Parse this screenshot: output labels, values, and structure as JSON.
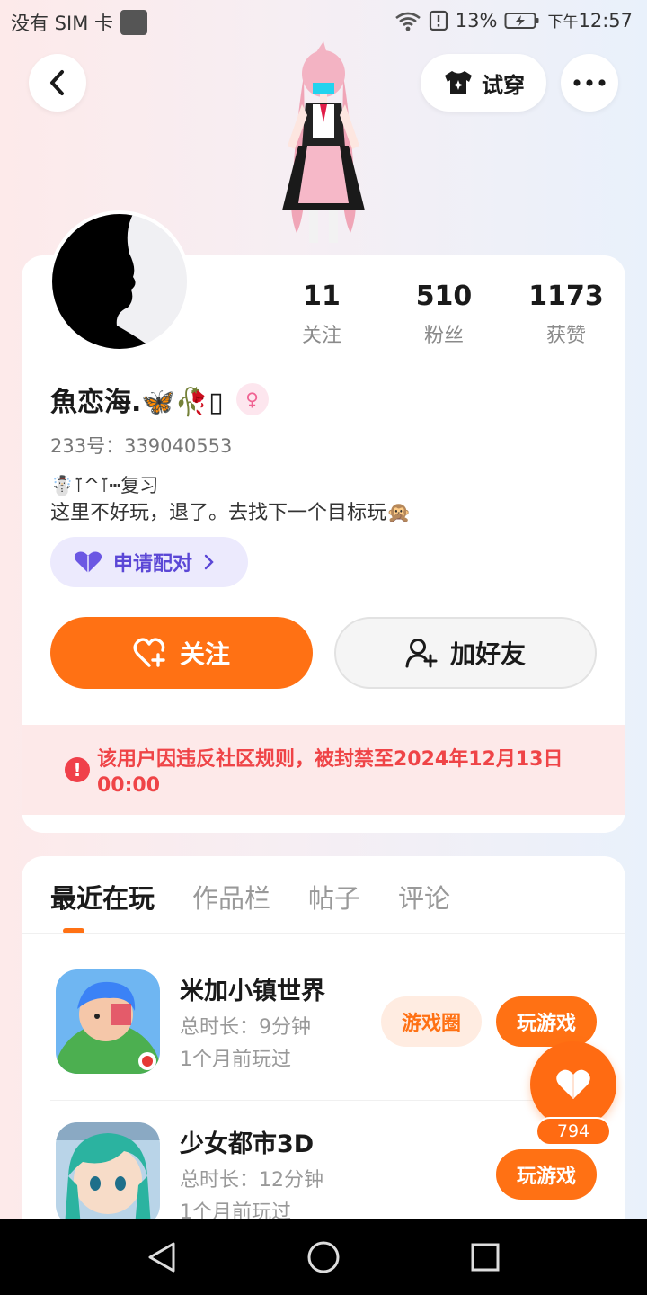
{
  "status_bar": {
    "carrier": "没有 SIM 卡",
    "battery": "13%",
    "ampm": "下午",
    "time": "12:57"
  },
  "top_bar": {
    "try_on_label": "试穿"
  },
  "profile": {
    "stats": [
      {
        "value": "11",
        "label": "关注"
      },
      {
        "value": "510",
        "label": "粉丝"
      },
      {
        "value": "1173",
        "label": "获赞"
      }
    ],
    "nickname": "魚恋海.🦋🥀▯",
    "user_id": "233号：339040553",
    "bio_line1": "☃️⊺̈^⊺̈┅复习",
    "bio_line2": "这里不好玩，退了。去找下一个目标玩🙊",
    "pair_label": "申请配对",
    "follow_label": "关注",
    "add_friend_label": "加好友",
    "ban_notice": "该用户因违反社区规则，被封禁至2024年12月13日 00:00"
  },
  "tabs": [
    "最近在玩",
    "作品栏",
    "帖子",
    "评论"
  ],
  "games": [
    {
      "title": "米加小镇世界",
      "duration": "总时长：9分钟",
      "last_played": "1个月前玩过",
      "circle_label": "游戏圈",
      "play_label": "玩游戏"
    },
    {
      "title": "少女都市3D",
      "duration": "总时长：12分钟",
      "last_played": "1个月前玩过",
      "play_label": "玩游戏"
    }
  ],
  "like_count": "794",
  "colors": {
    "accent": "#ff7114",
    "ban_text": "#ef4447",
    "ban_bg": "#fde9e9",
    "pair_bg": "#eceafd",
    "pair_text": "#5b47d6"
  }
}
